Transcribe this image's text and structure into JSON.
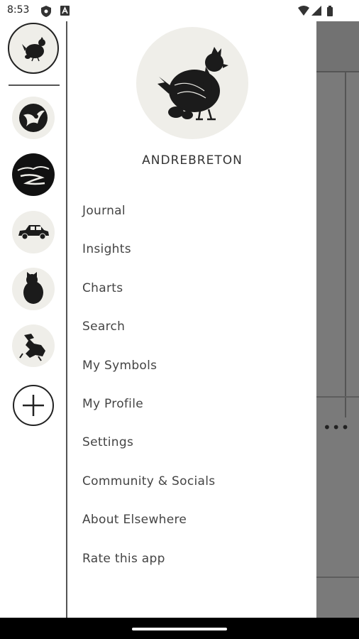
{
  "status_bar": {
    "time": "8:53"
  },
  "profile": {
    "username": "ANDREBRETON"
  },
  "menu": {
    "items": [
      {
        "label": "Journal"
      },
      {
        "label": "Insights"
      },
      {
        "label": "Charts"
      },
      {
        "label": "Search"
      },
      {
        "label": "My Symbols"
      },
      {
        "label": "My Profile"
      },
      {
        "label": "Settings"
      },
      {
        "label": "Community & Socials"
      },
      {
        "label": "About Elsewhere"
      },
      {
        "label": "Rate this app"
      }
    ]
  },
  "rail": {
    "avatars": [
      {
        "icon": "hen-icon",
        "selected": true
      },
      {
        "icon": "bird-icon"
      },
      {
        "icon": "landscape-icon"
      },
      {
        "icon": "car-icon"
      },
      {
        "icon": "cat-icon"
      },
      {
        "icon": "dragon-icon"
      }
    ]
  },
  "colors": {
    "scrim": "#7a7a7a",
    "avatar_bg": "#efeee9",
    "divider": "#555555"
  }
}
